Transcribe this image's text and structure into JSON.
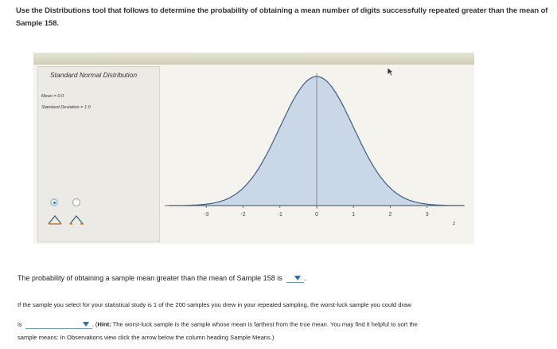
{
  "question": "Use the Distributions tool that follows to determine the probability of obtaining a mean number of digits successfully repeated greater than the mean of Sample 158.",
  "tool": {
    "title": "Standard Normal Distribution",
    "mean_label": "Mean = 0.0",
    "sd_label": "Standard Deviation = 1.0",
    "left_radio": "selected",
    "right_radio": "unselected"
  },
  "chart_data": {
    "type": "area",
    "distribution": "standard-normal",
    "mean": 0.0,
    "sd": 1.0,
    "xlim": [
      -4,
      4
    ],
    "xticks": [
      "-3",
      "-2",
      "-1",
      "0",
      "1",
      "2",
      "3"
    ],
    "xlabel": "z",
    "divider_at": 0,
    "shaded_region": "whole curve"
  },
  "probability_prompt": {
    "text": "The probability of obtaining a sample mean greater than the mean of Sample 158 is",
    "end": "."
  },
  "worst_luck": {
    "line1": "If the sample you select for your statistical study is 1 of the 200 samples you drew in your repeated sampling, the worst-luck sample you could draw",
    "is_label": "is",
    "line2_pre": ". (",
    "hint_label": "Hint:",
    "line2_post": " The worst-luck sample is the sample whose mean is farthest from the true mean. You may find it helpful to sort the",
    "line3": "sample means: In Observations view click the arrow below the column heading Sample Means.)"
  },
  "colors": {
    "curve_fill": "#c9d7e6",
    "curve_stroke": "#3b5f86",
    "axis": "#6b6b6b",
    "dropdown_arrow": "#2e6db0"
  }
}
